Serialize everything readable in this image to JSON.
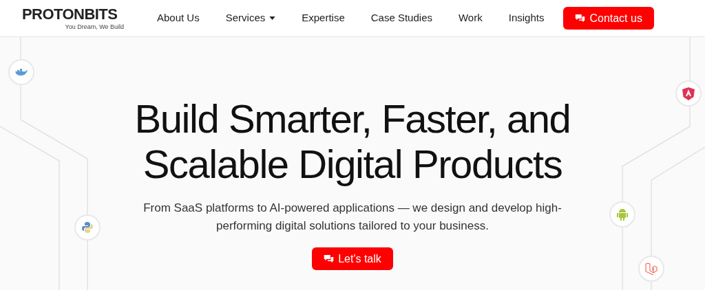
{
  "header": {
    "logo": "PROTONBITS",
    "tagline": "You Dream, We Build",
    "nav": [
      {
        "label": "About Us",
        "dropdown": false
      },
      {
        "label": "Services",
        "dropdown": true
      },
      {
        "label": "Expertise",
        "dropdown": false
      },
      {
        "label": "Case Studies",
        "dropdown": false
      },
      {
        "label": "Work",
        "dropdown": false
      },
      {
        "label": "Insights",
        "dropdown": false
      }
    ],
    "cta": "Contact us"
  },
  "hero": {
    "title_lines": [
      "Build Smarter, Faster, and",
      "Scalable Digital Products"
    ],
    "subtitle_lines": [
      "From SaaS platforms to AI-powered applications — we design and develop high-",
      "performing digital solutions tailored to your business."
    ],
    "button": "Let's talk"
  }
}
